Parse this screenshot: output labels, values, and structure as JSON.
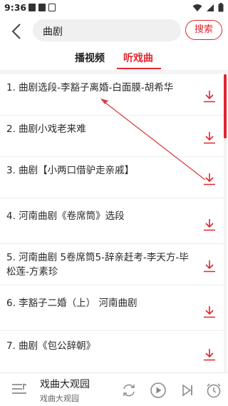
{
  "status_bar": {
    "time": "9:36"
  },
  "header": {
    "search_value": "曲剧",
    "search_button": "搜索"
  },
  "tabs": [
    {
      "label": "播视频",
      "active": false
    },
    {
      "label": "听戏曲",
      "active": true
    }
  ],
  "results": [
    {
      "title": "1. 曲剧选段-李豁子离婚-白面膜-胡希华"
    },
    {
      "title": "2. 曲剧小戏老来难"
    },
    {
      "title": "3. 曲剧【小两口借驴走亲戚】"
    },
    {
      "title": "4. 河南曲剧《卷席筒》选段"
    },
    {
      "title": "5. 河南曲剧 5卷席筒5-辞亲赶考-李天方-毕松莲-方素珍"
    },
    {
      "title": "6. 李豁子二婚（上） 河南曲剧"
    },
    {
      "title": "7. 曲剧《包公辞朝》"
    }
  ],
  "player": {
    "title": "戏曲大观园",
    "subtitle": "戏曲大观园"
  },
  "colors": {
    "accent": "#e0262f",
    "annotation_arrow": "#d94040"
  },
  "icons": {
    "back": "chevron-left-icon",
    "download": "download-icon",
    "playlist": "playlist-icon",
    "repeat": "repeat-icon",
    "play": "play-icon",
    "next": "skip-next-icon",
    "timer": "timer-icon"
  }
}
